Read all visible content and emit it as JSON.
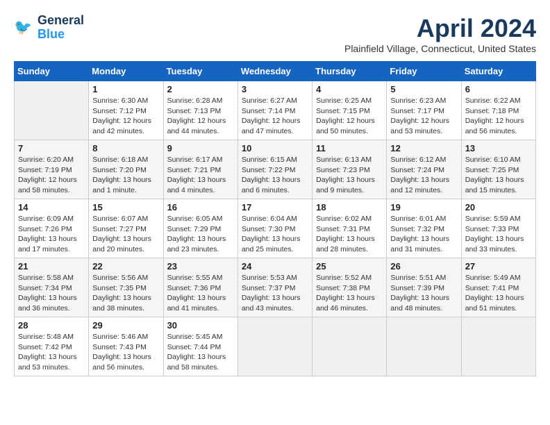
{
  "header": {
    "logo_line1": "General",
    "logo_line2": "Blue",
    "month": "April 2024",
    "location": "Plainfield Village, Connecticut, United States"
  },
  "weekdays": [
    "Sunday",
    "Monday",
    "Tuesday",
    "Wednesday",
    "Thursday",
    "Friday",
    "Saturday"
  ],
  "weeks": [
    [
      null,
      {
        "day": 1,
        "sunrise": "6:30 AM",
        "sunset": "7:12 PM",
        "daylight": "12 hours and 42 minutes."
      },
      {
        "day": 2,
        "sunrise": "6:28 AM",
        "sunset": "7:13 PM",
        "daylight": "12 hours and 44 minutes."
      },
      {
        "day": 3,
        "sunrise": "6:27 AM",
        "sunset": "7:14 PM",
        "daylight": "12 hours and 47 minutes."
      },
      {
        "day": 4,
        "sunrise": "6:25 AM",
        "sunset": "7:15 PM",
        "daylight": "12 hours and 50 minutes."
      },
      {
        "day": 5,
        "sunrise": "6:23 AM",
        "sunset": "7:17 PM",
        "daylight": "12 hours and 53 minutes."
      },
      {
        "day": 6,
        "sunrise": "6:22 AM",
        "sunset": "7:18 PM",
        "daylight": "12 hours and 56 minutes."
      }
    ],
    [
      {
        "day": 7,
        "sunrise": "6:20 AM",
        "sunset": "7:19 PM",
        "daylight": "12 hours and 58 minutes."
      },
      {
        "day": 8,
        "sunrise": "6:18 AM",
        "sunset": "7:20 PM",
        "daylight": "13 hours and 1 minute."
      },
      {
        "day": 9,
        "sunrise": "6:17 AM",
        "sunset": "7:21 PM",
        "daylight": "13 hours and 4 minutes."
      },
      {
        "day": 10,
        "sunrise": "6:15 AM",
        "sunset": "7:22 PM",
        "daylight": "13 hours and 6 minutes."
      },
      {
        "day": 11,
        "sunrise": "6:13 AM",
        "sunset": "7:23 PM",
        "daylight": "13 hours and 9 minutes."
      },
      {
        "day": 12,
        "sunrise": "6:12 AM",
        "sunset": "7:24 PM",
        "daylight": "13 hours and 12 minutes."
      },
      {
        "day": 13,
        "sunrise": "6:10 AM",
        "sunset": "7:25 PM",
        "daylight": "13 hours and 15 minutes."
      }
    ],
    [
      {
        "day": 14,
        "sunrise": "6:09 AM",
        "sunset": "7:26 PM",
        "daylight": "13 hours and 17 minutes."
      },
      {
        "day": 15,
        "sunrise": "6:07 AM",
        "sunset": "7:27 PM",
        "daylight": "13 hours and 20 minutes."
      },
      {
        "day": 16,
        "sunrise": "6:05 AM",
        "sunset": "7:29 PM",
        "daylight": "13 hours and 23 minutes."
      },
      {
        "day": 17,
        "sunrise": "6:04 AM",
        "sunset": "7:30 PM",
        "daylight": "13 hours and 25 minutes."
      },
      {
        "day": 18,
        "sunrise": "6:02 AM",
        "sunset": "7:31 PM",
        "daylight": "13 hours and 28 minutes."
      },
      {
        "day": 19,
        "sunrise": "6:01 AM",
        "sunset": "7:32 PM",
        "daylight": "13 hours and 31 minutes."
      },
      {
        "day": 20,
        "sunrise": "5:59 AM",
        "sunset": "7:33 PM",
        "daylight": "13 hours and 33 minutes."
      }
    ],
    [
      {
        "day": 21,
        "sunrise": "5:58 AM",
        "sunset": "7:34 PM",
        "daylight": "13 hours and 36 minutes."
      },
      {
        "day": 22,
        "sunrise": "5:56 AM",
        "sunset": "7:35 PM",
        "daylight": "13 hours and 38 minutes."
      },
      {
        "day": 23,
        "sunrise": "5:55 AM",
        "sunset": "7:36 PM",
        "daylight": "13 hours and 41 minutes."
      },
      {
        "day": 24,
        "sunrise": "5:53 AM",
        "sunset": "7:37 PM",
        "daylight": "13 hours and 43 minutes."
      },
      {
        "day": 25,
        "sunrise": "5:52 AM",
        "sunset": "7:38 PM",
        "daylight": "13 hours and 46 minutes."
      },
      {
        "day": 26,
        "sunrise": "5:51 AM",
        "sunset": "7:39 PM",
        "daylight": "13 hours and 48 minutes."
      },
      {
        "day": 27,
        "sunrise": "5:49 AM",
        "sunset": "7:41 PM",
        "daylight": "13 hours and 51 minutes."
      }
    ],
    [
      {
        "day": 28,
        "sunrise": "5:48 AM",
        "sunset": "7:42 PM",
        "daylight": "13 hours and 53 minutes."
      },
      {
        "day": 29,
        "sunrise": "5:46 AM",
        "sunset": "7:43 PM",
        "daylight": "13 hours and 56 minutes."
      },
      {
        "day": 30,
        "sunrise": "5:45 AM",
        "sunset": "7:44 PM",
        "daylight": "13 hours and 58 minutes."
      },
      null,
      null,
      null,
      null
    ]
  ]
}
